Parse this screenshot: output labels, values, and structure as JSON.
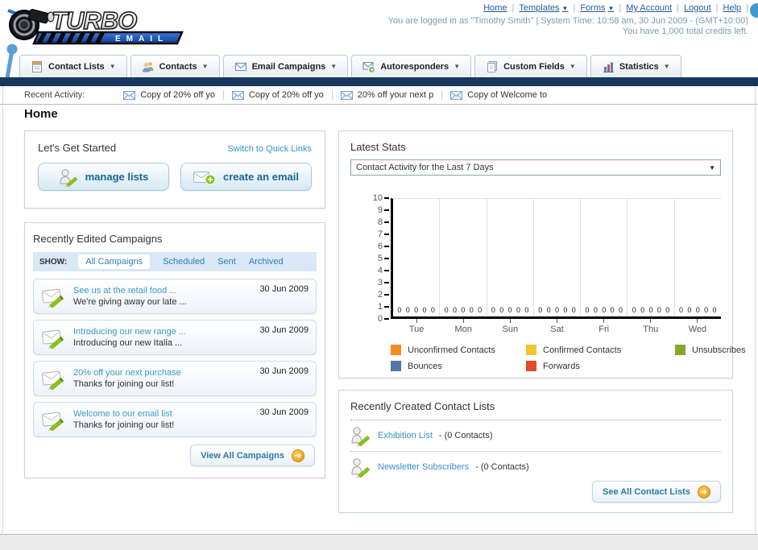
{
  "header": {
    "logo_title": "TURBO",
    "logo_subtitle": "EMAIL",
    "nav": [
      {
        "label": "Home",
        "caret": false
      },
      {
        "label": "Templates",
        "caret": true
      },
      {
        "label": "Forms",
        "caret": true
      },
      {
        "label": "My Account",
        "caret": false
      },
      {
        "label": "Logout",
        "caret": false
      },
      {
        "label": "Help",
        "caret": false
      }
    ],
    "login_line": "You are logged in as \"Timothy Smith\" | System Time: 10:58 am, 30 Jun 2009 - (GMT+10:00)",
    "credits_line": "You have 1,000 total credits left."
  },
  "tabs": [
    {
      "label": "Contact Lists"
    },
    {
      "label": "Contacts"
    },
    {
      "label": "Email Campaigns"
    },
    {
      "label": "Autoresponders"
    },
    {
      "label": "Custom Fields"
    },
    {
      "label": "Statistics"
    }
  ],
  "recent_activity": {
    "label": "Recent Activity:",
    "items": [
      "Copy of 20% off yo",
      "Copy of 20% off yo",
      "20% off your next p",
      "Copy of Welcome to"
    ]
  },
  "page_title": "Home",
  "get_started": {
    "title": "Let's Get Started",
    "switch_link": "Switch to Quick Links",
    "manage_lists_label": "manage lists",
    "create_email_label": "create an email"
  },
  "campaigns": {
    "title": "Recently Edited Campaigns",
    "show_label": "SHOW:",
    "filters": [
      "All Campaigns",
      "Scheduled",
      "Sent",
      "Archived"
    ],
    "active_filter": "All Campaigns",
    "items": [
      {
        "title": "See us at the retail food ...",
        "subtitle": "We're giving away our late ...",
        "date": "30 Jun 2009"
      },
      {
        "title": "Introducing our new range ...",
        "subtitle": "Introducing our new Italia ...",
        "date": "30 Jun 2009"
      },
      {
        "title": "20% off your next purchase",
        "subtitle": "Thanks for joining our list!",
        "date": "30 Jun 2009"
      },
      {
        "title": "Welcome to our email list",
        "subtitle": "Thanks for joining our list!",
        "date": "30 Jun 2009"
      }
    ],
    "view_all_label": "View All Campaigns"
  },
  "stats": {
    "title": "Latest Stats",
    "selected_option": "Contact Activity for the Last 7 Days"
  },
  "chart_data": {
    "type": "bar",
    "title": "Contact Activity for the Last 7 Days",
    "categories": [
      "Tue",
      "Mon",
      "Sun",
      "Sat",
      "Fri",
      "Thu",
      "Wed"
    ],
    "series": [
      {
        "name": "Unconfirmed Contacts",
        "color": "#f28c1e",
        "values": [
          0,
          0,
          0,
          0,
          0,
          0,
          0
        ]
      },
      {
        "name": "Confirmed Contacts",
        "color": "#f5c42c",
        "values": [
          0,
          0,
          0,
          0,
          0,
          0,
          0
        ]
      },
      {
        "name": "Unsubscribes",
        "color": "#86a828",
        "values": [
          0,
          0,
          0,
          0,
          0,
          0,
          0
        ]
      },
      {
        "name": "Bounces",
        "color": "#5674a7",
        "values": [
          0,
          0,
          0,
          0,
          0,
          0,
          0
        ]
      },
      {
        "name": "Forwards",
        "color": "#e2492f",
        "values": [
          0,
          0,
          0,
          0,
          0,
          0,
          0
        ]
      }
    ],
    "xlabel": "",
    "ylabel": "",
    "ylim": [
      0,
      10
    ],
    "ytick_step": 1,
    "grid": true,
    "legend_position": "bottom",
    "data_labels": "each bar group shows five 0 value labels"
  },
  "contact_lists": {
    "title": "Recently Created Contact Lists",
    "items": [
      {
        "name": "Exhibition List",
        "suffix": "- (0 Contacts)"
      },
      {
        "name": "Newsletter Subscribers",
        "suffix": "- (0 Contacts)"
      }
    ],
    "see_all_label": "See All Contact Lists"
  }
}
